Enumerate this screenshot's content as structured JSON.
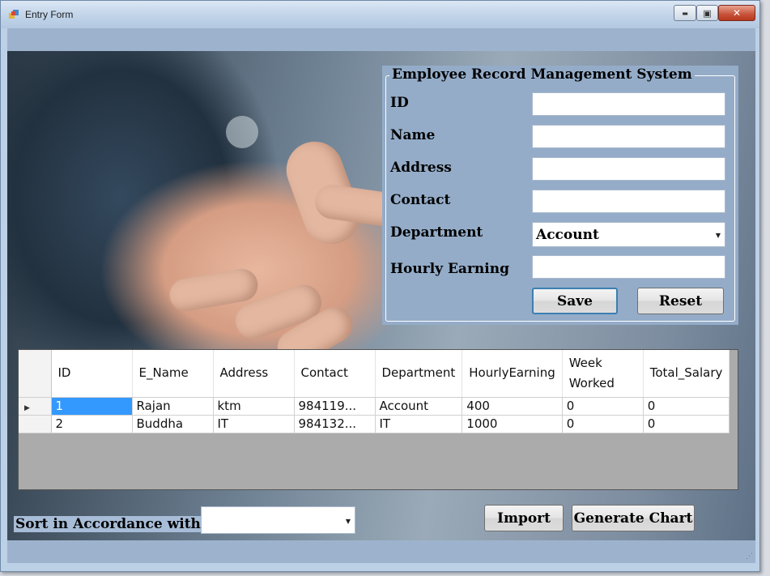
{
  "window": {
    "title": "Entry Form",
    "min_glyph": "▬",
    "max_glyph": "▣",
    "close_glyph": "✕"
  },
  "form": {
    "title": "Employee Record Management System",
    "labels": {
      "id": "ID",
      "name": "Name",
      "address": "Address",
      "contact": "Contact",
      "department": "Department",
      "hourly": "Hourly Earning"
    },
    "values": {
      "id": "",
      "name": "",
      "address": "",
      "contact": "",
      "hourly": ""
    },
    "department_selected": "Account",
    "save_label": "Save",
    "reset_label": "Reset"
  },
  "grid": {
    "columns": [
      "ID",
      "E_Name",
      "Address",
      "Contact",
      "Department",
      "HourlyEarning",
      "Week Worked",
      "Total_Salary"
    ],
    "rows": [
      [
        "1",
        "Rajan",
        "ktm",
        "984119...",
        "Account",
        "400",
        "0",
        "0"
      ],
      [
        "2",
        "Buddha",
        "IT",
        "984132...",
        "IT",
        "1000",
        "0",
        "0"
      ]
    ],
    "selected_row": 0
  },
  "bottom": {
    "sort_label": "Sort in Accordance with:",
    "sort_selected": "",
    "import_label": "Import",
    "chart_label": "Generate Chart"
  },
  "colors": {
    "window_bg": "#bcd0e6",
    "panel": "#94acc8",
    "selection": "#3399ff"
  },
  "icons": {
    "app": "app-icon",
    "dropdown": "chevron-down-icon",
    "row_pointer": "row-pointer-icon",
    "grip": "resize-grip-icon"
  }
}
